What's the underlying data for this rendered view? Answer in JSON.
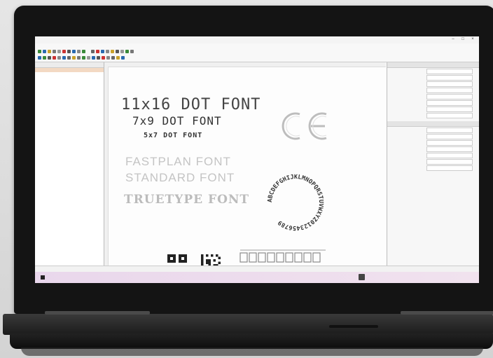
{
  "canvas_text": {
    "dot11x16": "11x16 DOT FONT",
    "dot7x9": "7x9 DOT FONT",
    "dot5x7": "5x7 DOT FONT",
    "fastplan": "FASTPLAN FONT",
    "standard": "STANDARD FONT",
    "truetype": "TRUETYPE FONT",
    "ring_text": "ABCDEFGHIJKLMNOPQRSTUVWXYZ0123456789"
  },
  "icons": {
    "ce": "ce-mark-icon",
    "qr1": "qr-code-icon",
    "qr2": "data-matrix-icon",
    "logo": "brand-logo-icon",
    "windows": "windows-start-icon"
  },
  "colors": {
    "selection_bg": "#f3d9c3",
    "taskbar": "#e9d7ec",
    "bezel": "#141414"
  }
}
